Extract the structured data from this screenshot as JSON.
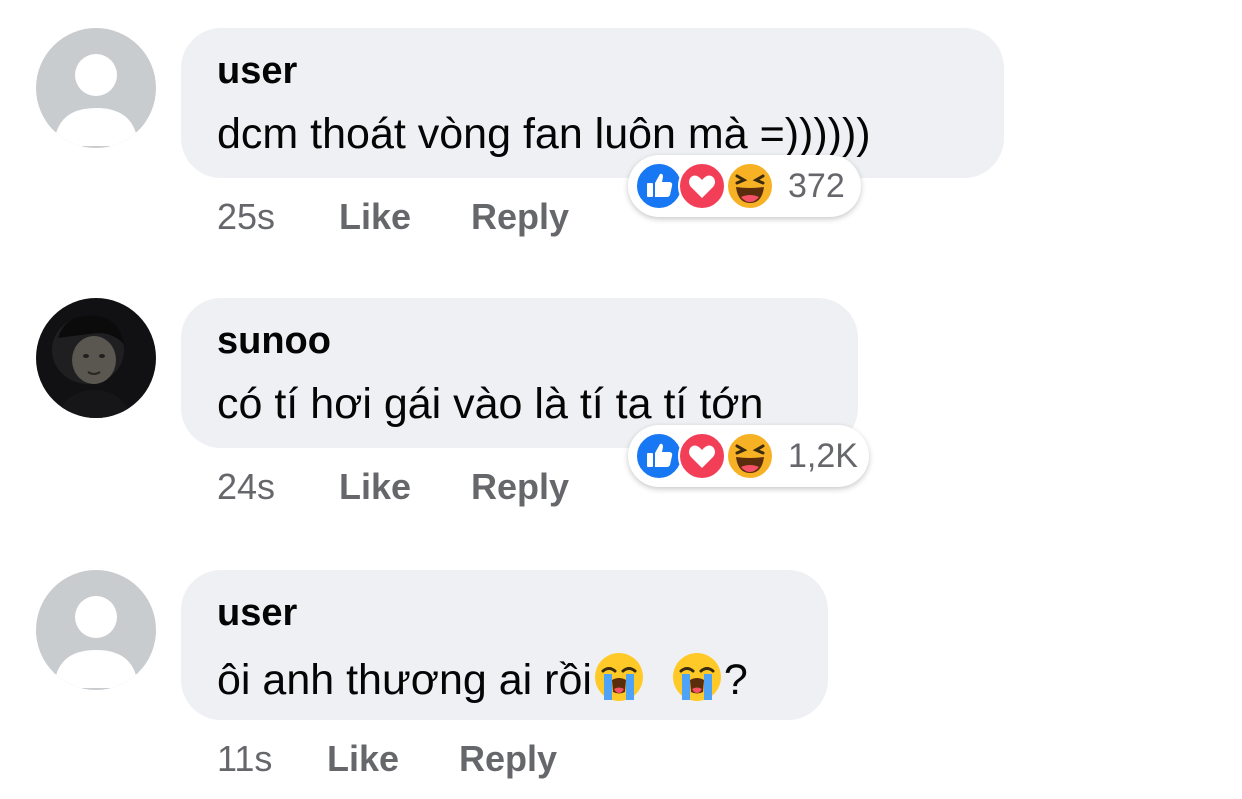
{
  "comments": [
    {
      "author": "user",
      "text": "dcm thoát vòng fan luôn mà =))))))",
      "time": "25s",
      "like_label": "Like",
      "reply_label": "Reply",
      "avatar": "default-avatar",
      "reactions": {
        "icons": [
          "like-icon",
          "love-icon",
          "haha-icon"
        ],
        "count": "372"
      }
    },
    {
      "author": "sunoo",
      "text": "có tí hơi gái vào là tí ta tí tớn",
      "time": "24s",
      "like_label": "Like",
      "reply_label": "Reply",
      "avatar": "profile-photo",
      "reactions": {
        "icons": [
          "like-icon",
          "love-icon",
          "haha-icon"
        ],
        "count": "1,2K"
      }
    },
    {
      "author": "user",
      "text_before": "ôi anh thương ai rồi",
      "text_emojis": [
        "loudly-crying-face",
        "loudly-crying-face"
      ],
      "text_after": "?",
      "time": "11s",
      "like_label": "Like",
      "reply_label": "Reply",
      "avatar": "default-avatar"
    }
  ],
  "colors": {
    "bubble": "#eff0f4",
    "text": "#050505",
    "meta": "#65676b",
    "like_blue": "#1877f2",
    "love_red": "#f33e58",
    "haha_yellow": "#f7b125"
  }
}
